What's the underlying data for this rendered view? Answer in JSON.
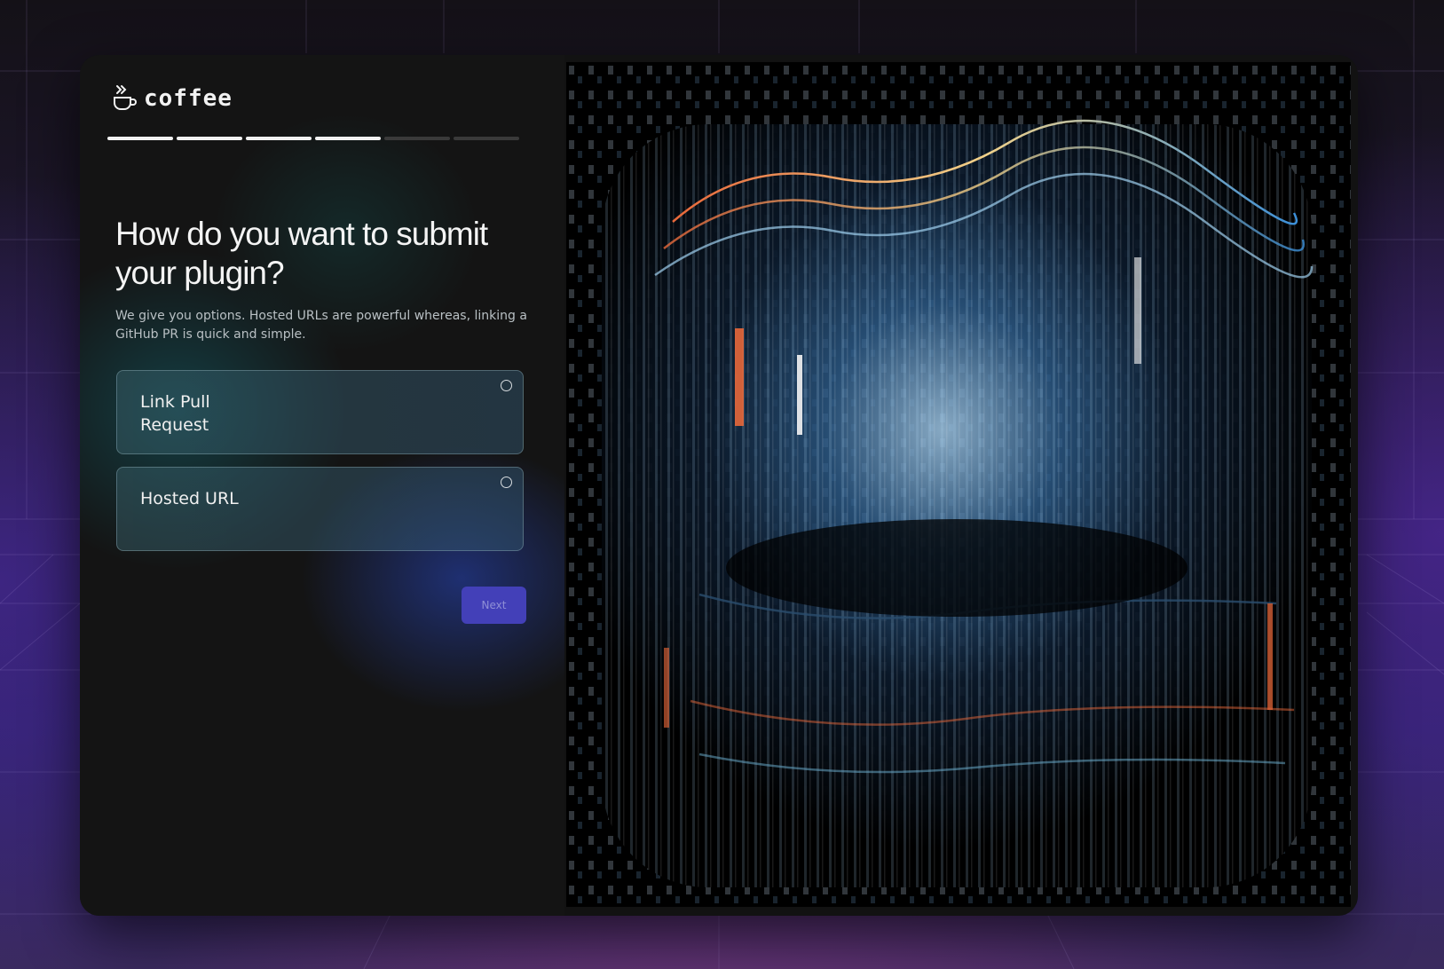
{
  "brand": {
    "name": "coffee",
    "icon": "coffee-cup-icon"
  },
  "progress": {
    "total_steps": 6,
    "completed_steps": 4
  },
  "heading": {
    "title": "How do you want to submit your plugin?"
  },
  "description": "We give you options. Hosted URLs are powerful whereas, linking a GitHub PR is quick and simple.",
  "options": [
    {
      "label": "Link Pull Request",
      "selected": false
    },
    {
      "label": "Hosted URL",
      "selected": false
    }
  ],
  "actions": {
    "next_label": "Next"
  },
  "colors": {
    "accent": "#4340b8",
    "card_bg": "#141414",
    "option_border": "#a9c6d0",
    "art_orange": "#e8683a",
    "art_blue": "#3b8fd8"
  }
}
